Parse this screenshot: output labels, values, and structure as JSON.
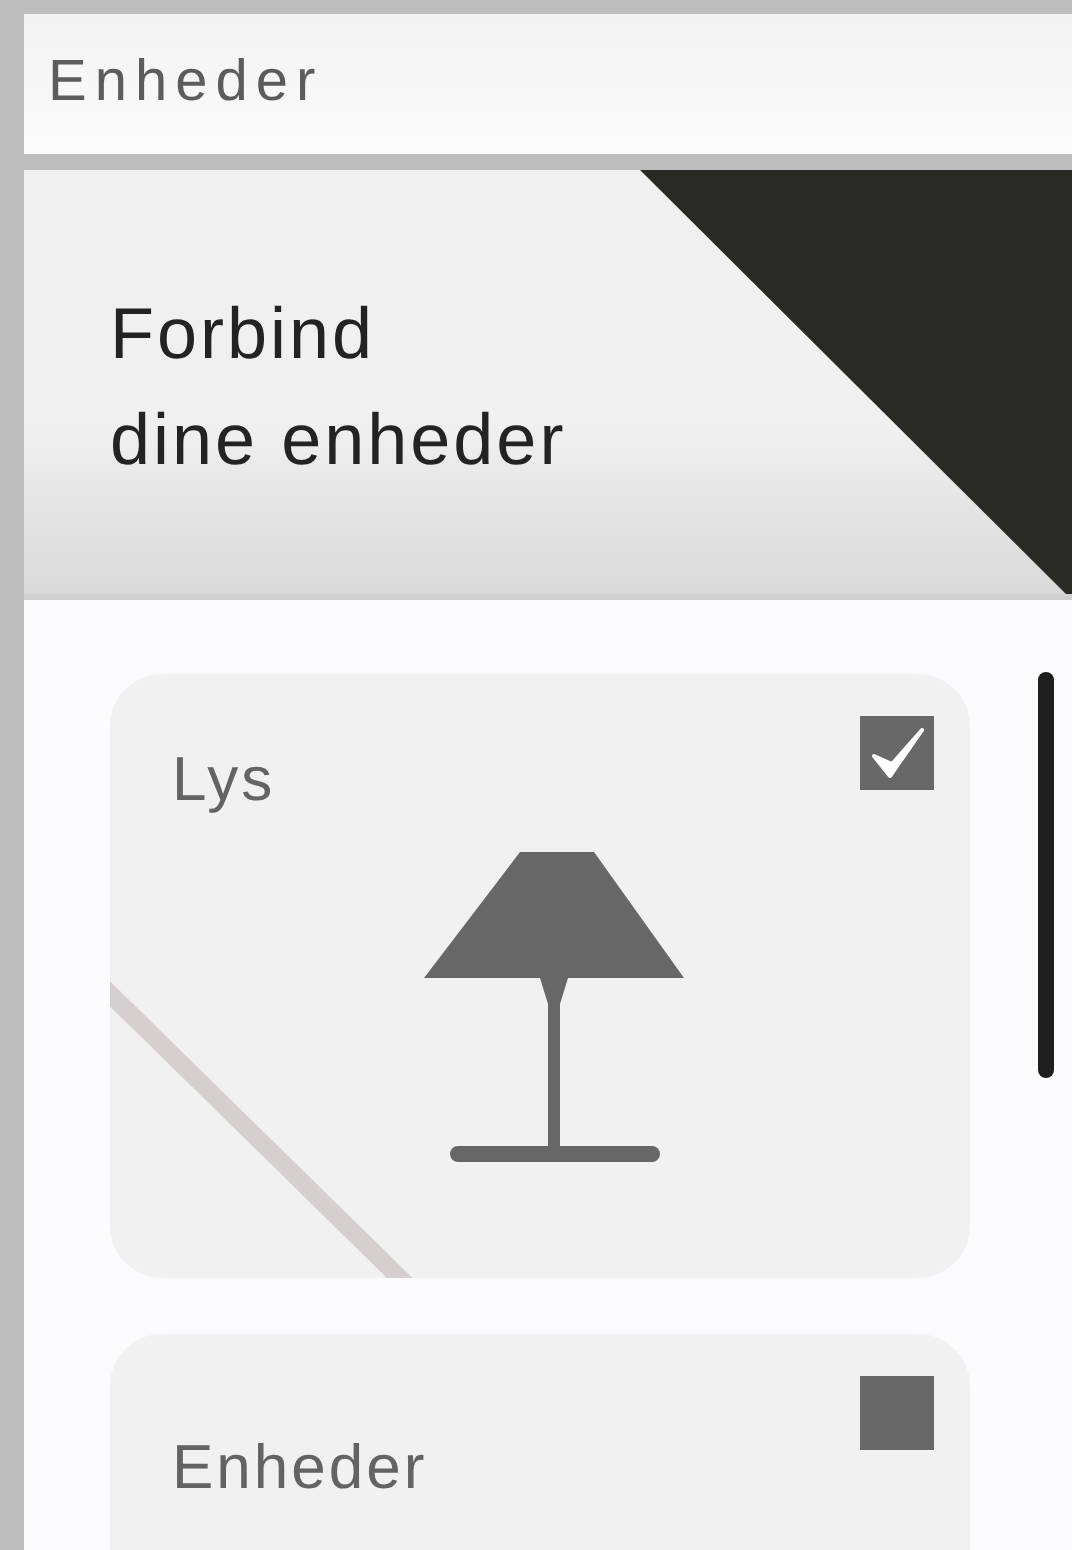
{
  "header": {
    "title": "Enheder"
  },
  "banner": {
    "title": "Forbind\ndine enheder"
  },
  "devices": [
    {
      "name": "Lys",
      "checked": true,
      "kind": "lamp"
    },
    {
      "name": "Enheder",
      "checked": false,
      "kind": "blank"
    }
  ]
}
